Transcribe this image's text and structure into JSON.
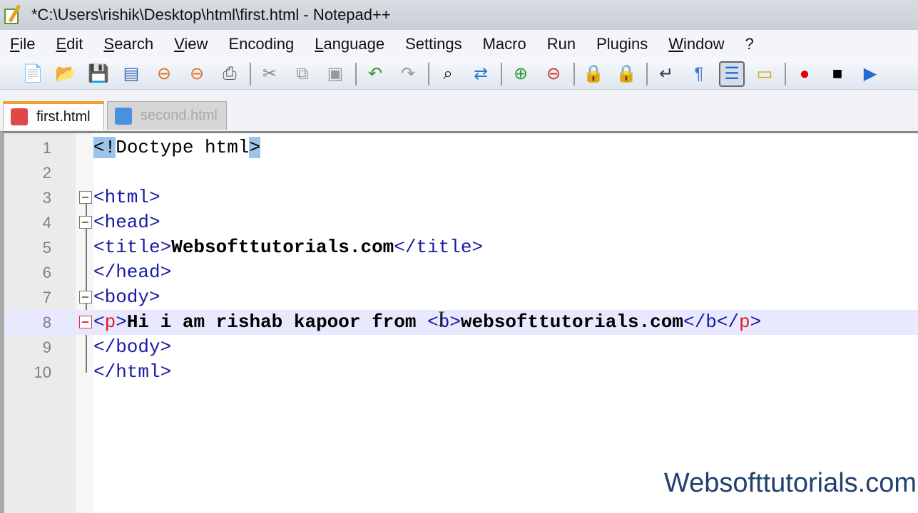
{
  "window": {
    "title": "*C:\\Users\\rishik\\Desktop\\html\\first.html - Notepad++"
  },
  "menu": [
    {
      "label": "File",
      "u": "F",
      "rest": "ile"
    },
    {
      "label": "Edit",
      "u": "E",
      "rest": "dit"
    },
    {
      "label": "Search",
      "u": "S",
      "rest": "earch"
    },
    {
      "label": "View",
      "u": "V",
      "rest": "iew"
    },
    {
      "label": "Encoding",
      "u": "",
      "rest": "Encoding"
    },
    {
      "label": "Language",
      "u": "L",
      "rest": "anguage"
    },
    {
      "label": "Settings",
      "u": "",
      "rest": "Settings"
    },
    {
      "label": "Macro",
      "u": "",
      "rest": "Macro"
    },
    {
      "label": "Run",
      "u": "",
      "rest": "Run"
    },
    {
      "label": "Plugins",
      "u": "",
      "rest": "Plugins"
    },
    {
      "label": "Window",
      "u": "W",
      "rest": "indow"
    },
    {
      "label": "?",
      "u": "?",
      "rest": ""
    }
  ],
  "toolbar": [
    "new-file",
    "open-file",
    "save",
    "save-all",
    "close",
    "close-all",
    "print",
    "|",
    "cut",
    "copy",
    "paste",
    "|",
    "undo",
    "redo",
    "|",
    "find",
    "replace",
    "|",
    "zoom-in",
    "zoom-out",
    "|",
    "sync-vertical",
    "sync-horizontal",
    "|",
    "word-wrap",
    "show-all-chars",
    "indent-guide",
    "user-language",
    "|",
    "record-macro",
    "stop-record",
    "play-macro"
  ],
  "tabs": [
    {
      "label": "first.html",
      "active": true,
      "icon_color": "#e04848"
    },
    {
      "label": "second.html",
      "active": false,
      "icon_color": "#4a90e0"
    }
  ],
  "editor": {
    "current_line": 8,
    "lines": [
      {
        "n": "1",
        "seg": [
          {
            "t": "<!",
            "c": "doc hl"
          },
          {
            "t": "Doctype html",
            "c": "doc"
          },
          {
            "t": ">",
            "c": "doc hl"
          }
        ]
      },
      {
        "n": "2",
        "seg": []
      },
      {
        "n": "3",
        "seg": [
          {
            "t": "<html>",
            "c": "tag"
          }
        ]
      },
      {
        "n": "4",
        "seg": [
          {
            "t": "<head>",
            "c": "tag"
          }
        ]
      },
      {
        "n": "5",
        "seg": [
          {
            "t": "<title>",
            "c": "tag"
          },
          {
            "t": "Websofttutorials.com",
            "c": ""
          },
          {
            "t": "</title>",
            "c": "tag"
          }
        ]
      },
      {
        "n": "6",
        "seg": [
          {
            "t": "</head>",
            "c": "tag"
          }
        ]
      },
      {
        "n": "7",
        "seg": [
          {
            "t": "<body>",
            "c": "tag"
          }
        ]
      },
      {
        "n": "8",
        "seg": [
          {
            "t": "<",
            "c": "tag"
          },
          {
            "t": "p",
            "c": "tagred"
          },
          {
            "t": ">",
            "c": "tag"
          },
          {
            "t": "Hi i am rishab kapoor from ",
            "c": ""
          },
          {
            "t": "<b>",
            "c": "tag"
          },
          {
            "t": "websofttutorials.com",
            "c": ""
          },
          {
            "t": "</b</",
            "c": "tag"
          },
          {
            "t": "p",
            "c": "tagred"
          },
          {
            "t": ">",
            "c": "tag"
          }
        ]
      },
      {
        "n": "9",
        "seg": [
          {
            "t": "</body>",
            "c": "tag"
          }
        ]
      },
      {
        "n": "10",
        "seg": [
          {
            "t": "</html>",
            "c": "tag"
          }
        ]
      }
    ]
  },
  "watermark": "Websofttutorials.com"
}
